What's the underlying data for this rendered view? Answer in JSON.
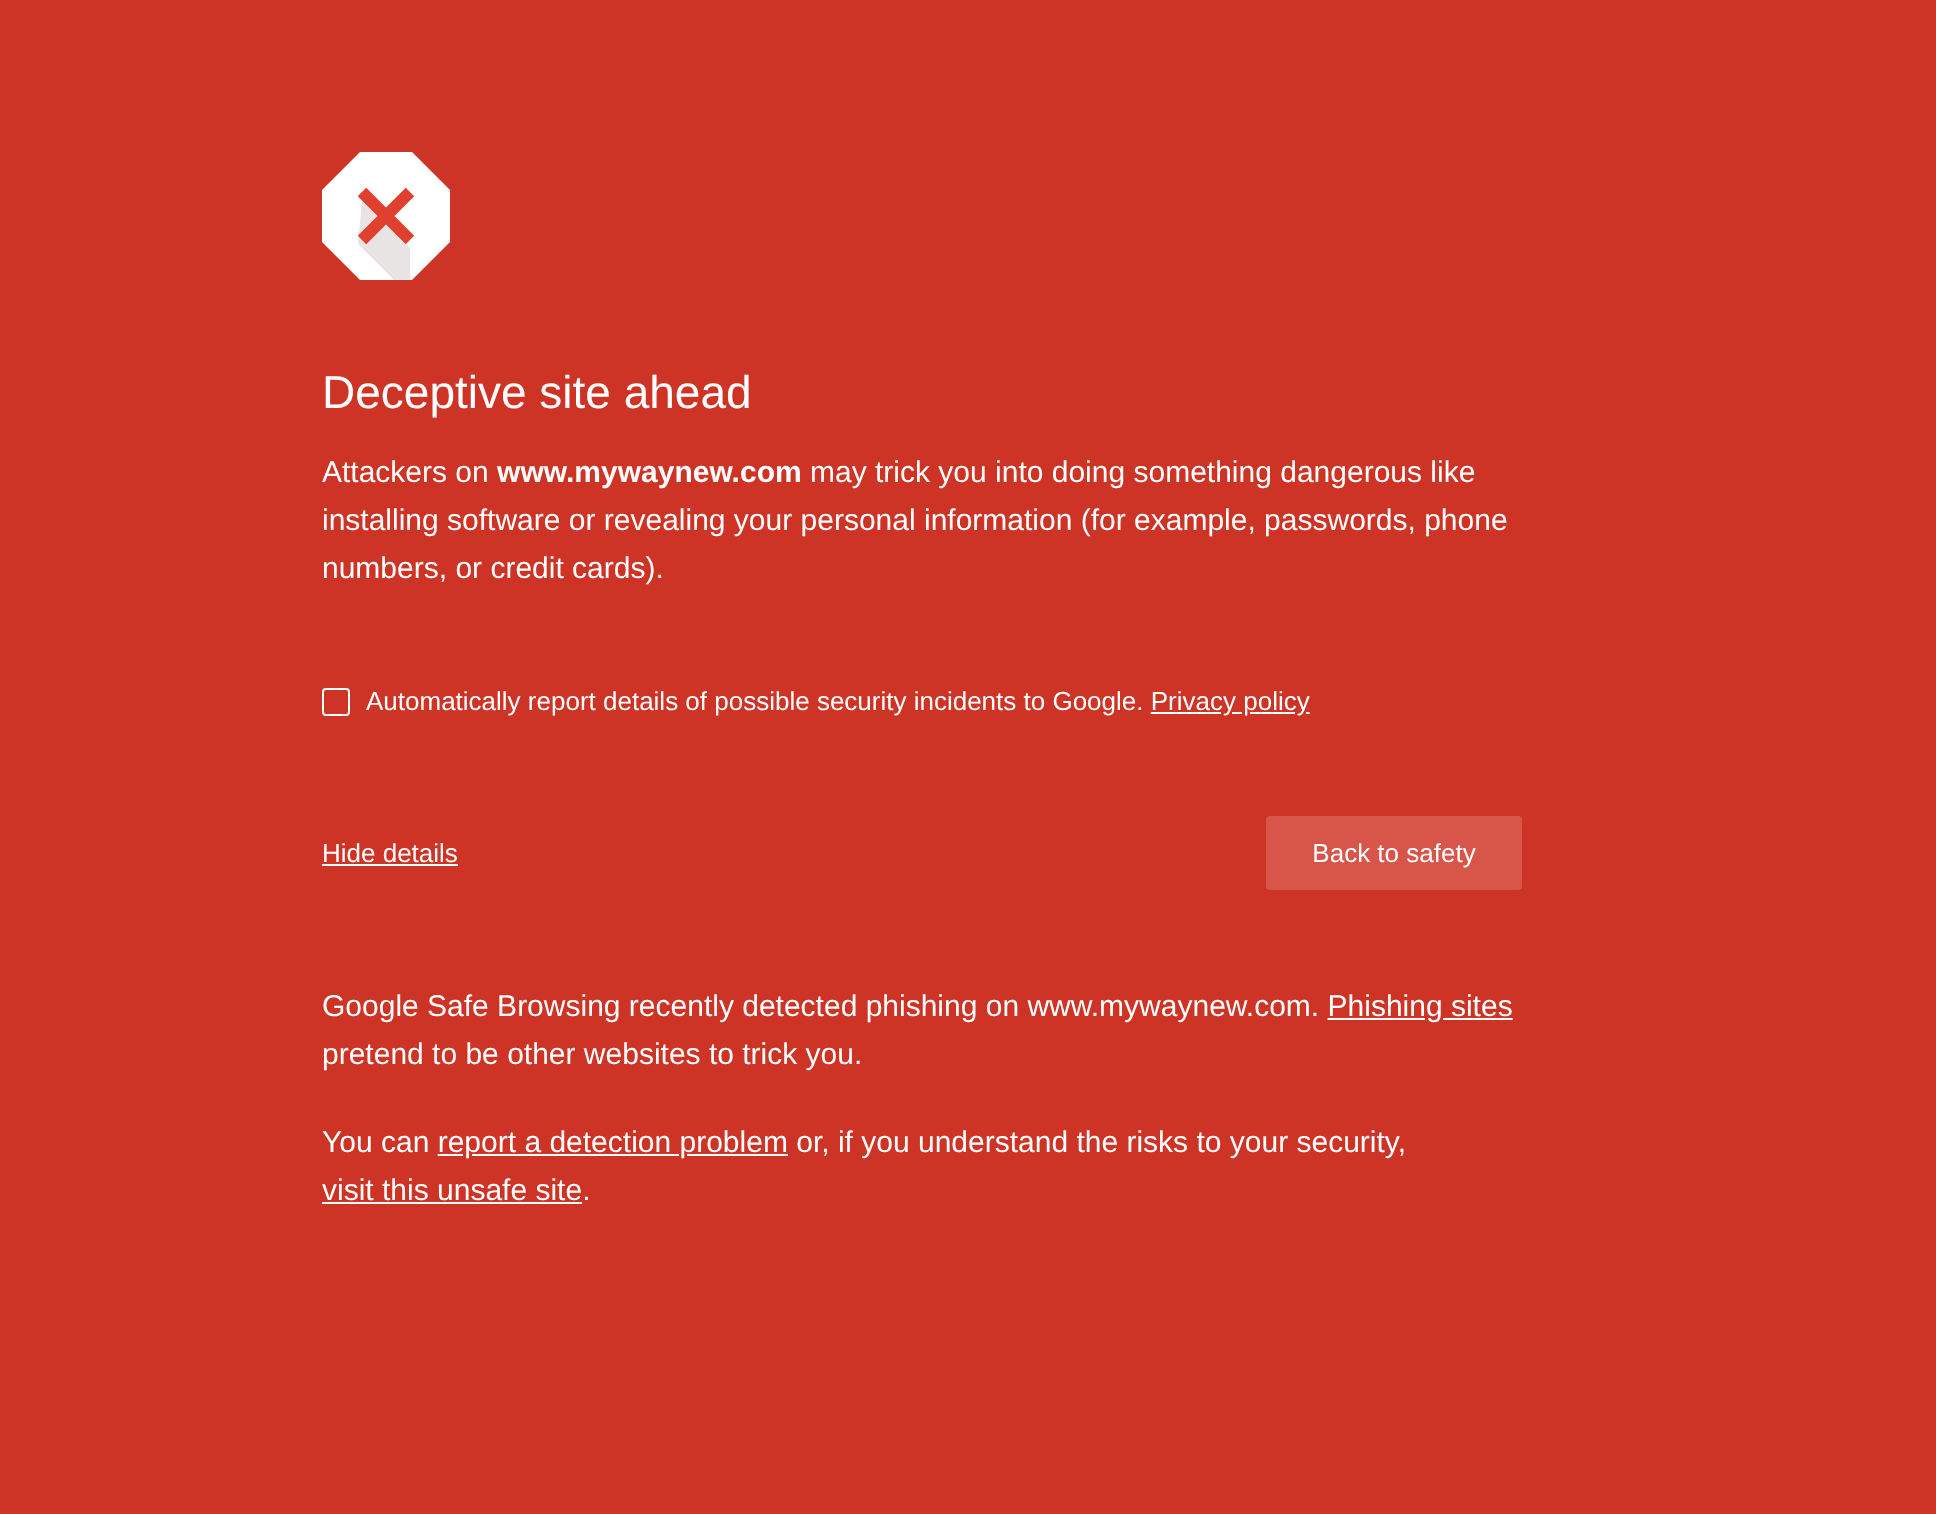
{
  "heading": "Deceptive site ahead",
  "summary": [
    {
      "kind": "text",
      "text": "Attackers on **www.mywaynew.com** may trick you into doing something dangerous like installing software or revealing your personal information (for example, passwords, phone numbers, or credit cards)."
    }
  ],
  "report_option": {
    "checked": false,
    "parts": [
      {
        "kind": "text",
        "text": "Automatically report details of possible security incidents to Google. "
      },
      {
        "kind": "link",
        "text": "Privacy policy"
      }
    ]
  },
  "details_link": "Hide details",
  "primary_button": "Back to safety",
  "details": [
    [
      {
        "kind": "text",
        "text": "Google Safe Browsing recently detected phishing on www.mywaynew.com. "
      },
      {
        "kind": "link",
        "text": "Phishing sites"
      },
      {
        "kind": "text",
        "text": " pretend to be other websites to trick you."
      }
    ],
    [
      {
        "kind": "text",
        "text": "You can "
      },
      {
        "kind": "link",
        "text": "report a detection problem"
      },
      {
        "kind": "text",
        "text": " or, if you understand the risks to your security, "
      },
      {
        "kind": "link",
        "text": "visit this unsafe site"
      },
      {
        "kind": "text",
        "text": "."
      }
    ]
  ]
}
